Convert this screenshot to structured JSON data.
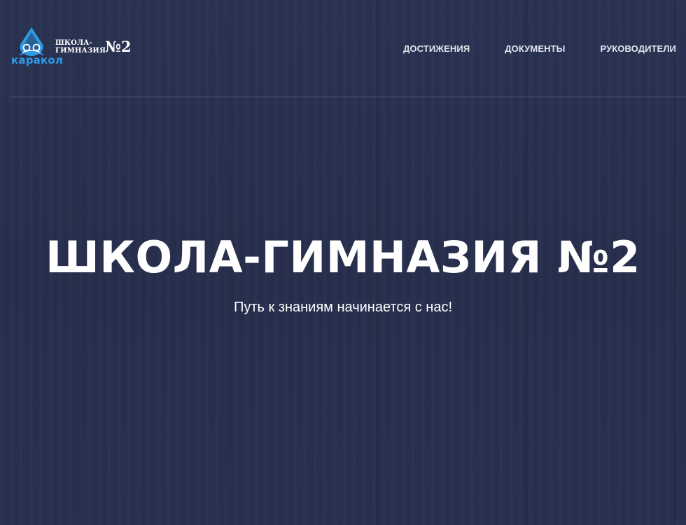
{
  "header": {
    "logo": {
      "icon": "karakol-droplet-logo-icon",
      "brand": "каракол",
      "name_line1": "ШКОЛА-",
      "name_line2": "ГИМНАЗИЯ",
      "number": "№2"
    },
    "nav": [
      {
        "label": "ДОСТИЖЕНИЯ"
      },
      {
        "label": "ДОКУМЕНТЫ"
      },
      {
        "label": "РУКОВОДИТЕЛИ"
      }
    ]
  },
  "hero": {
    "title": "ШКОЛА-ГИМНАЗИЯ №2",
    "subtitle": "Путь к знаниям начинается с нас!"
  },
  "colors": {
    "background": "#283150",
    "logo_accent": "#2e9be6",
    "text": "#ffffff",
    "nav_text": "#e3e6ee"
  }
}
